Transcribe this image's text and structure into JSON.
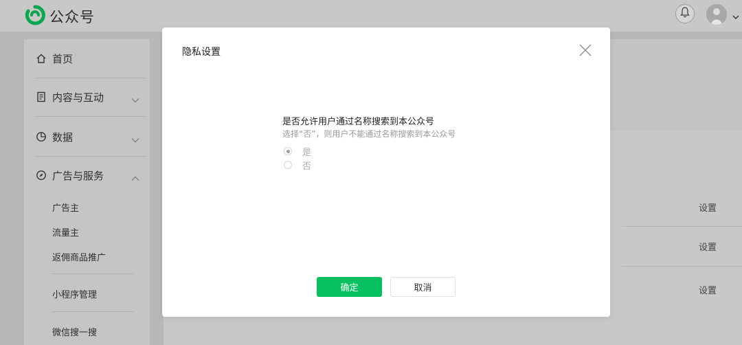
{
  "header": {
    "app_name": "公众号",
    "brand_color": "#07c160"
  },
  "sidebar": {
    "items": [
      {
        "label": "首页",
        "icon": "home-icon"
      },
      {
        "label": "内容与互动",
        "icon": "document-icon",
        "expanded": false
      },
      {
        "label": "数据",
        "icon": "pie-chart-icon",
        "expanded": false
      },
      {
        "label": "广告与服务",
        "icon": "compass-icon",
        "expanded": true
      }
    ],
    "sub_items": [
      "广告主",
      "流量主",
      "返佣商品推广",
      "小程序管理",
      "微信搜一搜"
    ]
  },
  "content": {
    "row_links": [
      "设置",
      "设置",
      "设置"
    ]
  },
  "dialog": {
    "title": "隐私设置",
    "question": "是否允许用户通过名称搜索到本公众号",
    "hint": "选择“否”，则用户不能通过名称搜索到本公众号",
    "options": [
      {
        "label": "是",
        "selected": true
      },
      {
        "label": "否",
        "selected": false
      }
    ],
    "confirm_label": "确定",
    "cancel_label": "取消"
  }
}
